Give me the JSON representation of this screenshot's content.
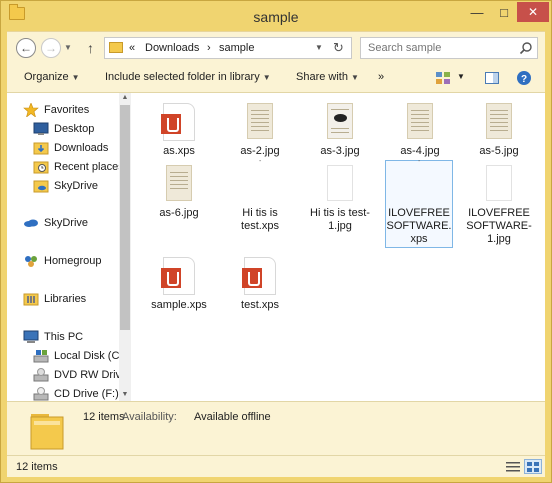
{
  "window": {
    "title": "sample"
  },
  "navigation": {
    "breadcrumb_prefix": "«",
    "breadcrumb": [
      "Downloads",
      "sample"
    ],
    "separator": "›",
    "search_placeholder": "Search sample"
  },
  "toolbar": {
    "organize": "Organize",
    "include_in_library": "Include selected folder in library",
    "share_with": "Share with",
    "more": "»"
  },
  "nav_pane": {
    "items": [
      {
        "label": "Favorites",
        "icon": "star-icon"
      },
      {
        "label": "Desktop",
        "icon": "desktop-icon"
      },
      {
        "label": "Downloads",
        "icon": "downloads-folder-icon"
      },
      {
        "label": "Recent places",
        "icon": "recent-places-icon"
      },
      {
        "label": "SkyDrive",
        "icon": "skydrive-folder-icon"
      },
      {
        "label": "SkyDrive",
        "icon": "skydrive-icon"
      },
      {
        "label": "Homegroup",
        "icon": "homegroup-icon"
      },
      {
        "label": "Libraries",
        "icon": "libraries-icon"
      },
      {
        "label": "This PC",
        "icon": "computer-icon"
      },
      {
        "label": "Local Disk (C:",
        "icon": "drive-icon"
      },
      {
        "label": "DVD RW Drive",
        "icon": "dvd-drive-icon"
      },
      {
        "label": "CD Drive (F:) I",
        "icon": "cd-drive-icon"
      }
    ]
  },
  "files": [
    {
      "name": "as.xps",
      "type": "xps"
    },
    {
      "name": "as-2.jpg",
      "type": "jpg-doc"
    },
    {
      "name": "as-3.jpg",
      "type": "jpg-doc-image"
    },
    {
      "name": "as-4.jpg",
      "type": "jpg-doc"
    },
    {
      "name": "as-5.jpg",
      "type": "jpg-doc"
    },
    {
      "name": "as-6.jpg",
      "type": "jpg-doc"
    },
    {
      "name": "Hi tis is test.xps",
      "type": "blank"
    },
    {
      "name": "Hi tis is test-1.jpg",
      "type": "blank"
    },
    {
      "name": "ILOVEFREESOFTWARE.xps",
      "type": "blank",
      "selected": true
    },
    {
      "name": "ILOVEFREESOFTWARE-1.jpg",
      "type": "blank"
    },
    {
      "name": "sample.xps",
      "type": "xps"
    },
    {
      "name": "test.xps",
      "type": "xps"
    }
  ],
  "details": {
    "item_count": "12 items",
    "availability_label": "Availability:",
    "availability_value": "Available offline"
  },
  "status": {
    "item_count": "12 items"
  },
  "colors": {
    "frame": "#f0d470",
    "chrome": "#fbf3d4",
    "xps_red": "#d04428",
    "selection": "#7fb7e6",
    "close_button": "#c7504a"
  }
}
